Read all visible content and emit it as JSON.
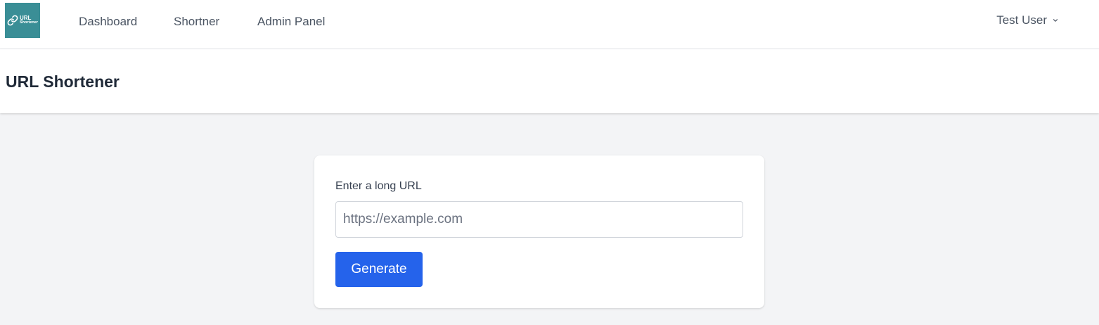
{
  "brand": {
    "logo_line1": "URL",
    "logo_line2": "Shortener",
    "logo_color": "#3a8e96",
    "logo_icon": "link-icon"
  },
  "nav": {
    "items": [
      {
        "label": "Dashboard"
      },
      {
        "label": "Shortner"
      },
      {
        "label": "Admin Panel"
      }
    ],
    "user_label": "Test User",
    "user_icon": "chevron-down-icon"
  },
  "header": {
    "title": "URL Shortener"
  },
  "form": {
    "label": "Enter a long URL",
    "input_value": "",
    "input_placeholder": "https://example.com",
    "submit_label": "Generate",
    "submit_color": "#2563eb"
  }
}
